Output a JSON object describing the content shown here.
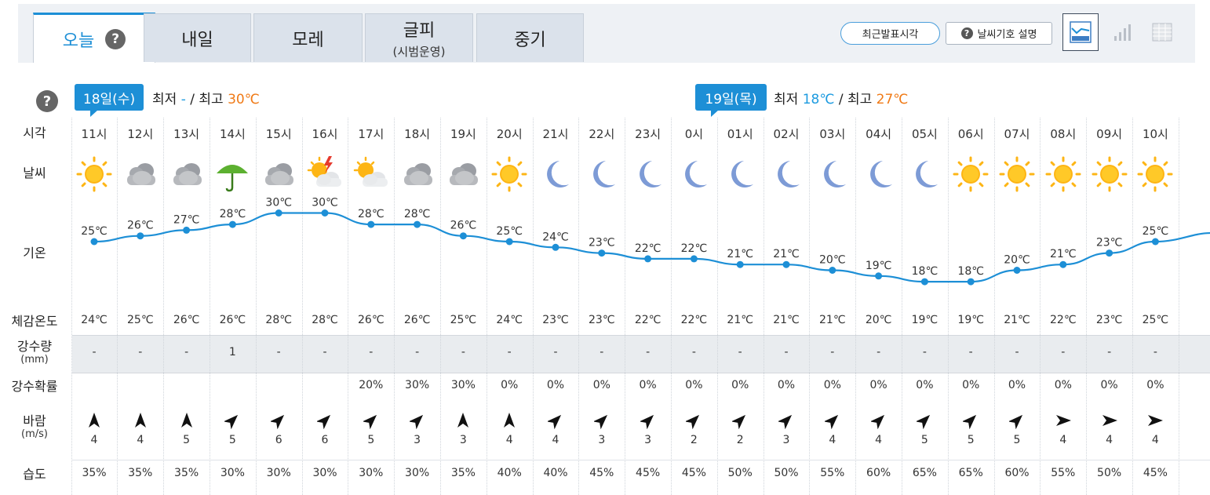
{
  "tabs": [
    {
      "label": "오늘",
      "sub": "",
      "active": true,
      "help": "?"
    },
    {
      "label": "내일",
      "sub": ""
    },
    {
      "label": "모레",
      "sub": ""
    },
    {
      "label": "글피",
      "sub": "(시범운영)"
    },
    {
      "label": "중기",
      "sub": ""
    }
  ],
  "toolbar": {
    "recent_label": "최근발표시각",
    "legend_label": "날씨기호 설명",
    "legend_icon": "?"
  },
  "help_icon": "?",
  "days": [
    {
      "badge": "18일(수)",
      "low_label": "최저",
      "low": "-",
      "sep": "/",
      "high_label": "최고",
      "high": "30℃"
    },
    {
      "badge": "19일(목)",
      "low_label": "최저",
      "low": "18℃",
      "sep": "/",
      "high_label": "최고",
      "high": "27℃"
    }
  ],
  "row_labels": {
    "hour": "시각",
    "weather": "날씨",
    "temp": "기온",
    "feels": "체감온도",
    "rain": "강수량",
    "rain_unit": "(mm)",
    "prob": "강수확률",
    "wind": "바람",
    "wind_unit": "(m/s)",
    "humidity": "습도"
  },
  "colors": {
    "accent": "#1d8fd6",
    "low": "#1d9be0",
    "high": "#f07a16"
  },
  "forecast": [
    {
      "hour": "11시",
      "weather": "sun",
      "temp": 25,
      "temp_label": "25℃",
      "feels": "24℃",
      "rain": "-",
      "prob": "",
      "wind_dir": "north",
      "wind": "4",
      "humidity": "35%"
    },
    {
      "hour": "12시",
      "weather": "cloud",
      "temp": 26,
      "temp_label": "26℃",
      "feels": "25℃",
      "rain": "-",
      "prob": "",
      "wind_dir": "north",
      "wind": "4",
      "humidity": "35%"
    },
    {
      "hour": "13시",
      "weather": "cloud",
      "temp": 27,
      "temp_label": "27℃",
      "feels": "26℃",
      "rain": "-",
      "prob": "",
      "wind_dir": "north",
      "wind": "5",
      "humidity": "35%"
    },
    {
      "hour": "14시",
      "weather": "umbrella",
      "temp": 28,
      "temp_label": "28℃",
      "feels": "26℃",
      "rain": "1",
      "prob": "",
      "wind_dir": "northeast",
      "wind": "5",
      "humidity": "30%"
    },
    {
      "hour": "15시",
      "weather": "cloud",
      "temp": 30,
      "temp_label": "30℃",
      "feels": "28℃",
      "rain": "-",
      "prob": "",
      "wind_dir": "northeast",
      "wind": "6",
      "humidity": "30%"
    },
    {
      "hour": "16시",
      "weather": "thunder",
      "temp": 30,
      "temp_label": "30℃",
      "feels": "28℃",
      "rain": "-",
      "prob": "",
      "wind_dir": "northeast",
      "wind": "6",
      "humidity": "30%"
    },
    {
      "hour": "17시",
      "weather": "suncloud",
      "temp": 28,
      "temp_label": "28℃",
      "feels": "26℃",
      "rain": "-",
      "prob": "20%",
      "wind_dir": "northeast",
      "wind": "5",
      "humidity": "30%"
    },
    {
      "hour": "18시",
      "weather": "cloud",
      "temp": 28,
      "temp_label": "28℃",
      "feels": "26℃",
      "rain": "-",
      "prob": "30%",
      "wind_dir": "northeast",
      "wind": "3",
      "humidity": "30%"
    },
    {
      "hour": "19시",
      "weather": "cloud",
      "temp": 26,
      "temp_label": "26℃",
      "feels": "25℃",
      "rain": "-",
      "prob": "30%",
      "wind_dir": "north",
      "wind": "3",
      "humidity": "35%"
    },
    {
      "hour": "20시",
      "weather": "sun",
      "temp": 25,
      "temp_label": "25℃",
      "feels": "24℃",
      "rain": "-",
      "prob": "0%",
      "wind_dir": "north",
      "wind": "4",
      "humidity": "40%"
    },
    {
      "hour": "21시",
      "weather": "moon",
      "temp": 24,
      "temp_label": "24℃",
      "feels": "23℃",
      "rain": "-",
      "prob": "0%",
      "wind_dir": "northeast",
      "wind": "4",
      "humidity": "40%"
    },
    {
      "hour": "22시",
      "weather": "moon",
      "temp": 23,
      "temp_label": "23℃",
      "feels": "23℃",
      "rain": "-",
      "prob": "0%",
      "wind_dir": "northeast",
      "wind": "3",
      "humidity": "45%"
    },
    {
      "hour": "23시",
      "weather": "moon",
      "temp": 22,
      "temp_label": "22℃",
      "feels": "22℃",
      "rain": "-",
      "prob": "0%",
      "wind_dir": "northeast",
      "wind": "3",
      "humidity": "45%"
    },
    {
      "hour": "0시",
      "weather": "moon",
      "temp": 22,
      "temp_label": "22℃",
      "feels": "22℃",
      "rain": "-",
      "prob": "0%",
      "wind_dir": "northeast",
      "wind": "2",
      "humidity": "45%"
    },
    {
      "hour": "01시",
      "weather": "moon",
      "temp": 21,
      "temp_label": "21℃",
      "feels": "21℃",
      "rain": "-",
      "prob": "0%",
      "wind_dir": "northeast",
      "wind": "2",
      "humidity": "50%"
    },
    {
      "hour": "02시",
      "weather": "moon",
      "temp": 21,
      "temp_label": "21℃",
      "feels": "21℃",
      "rain": "-",
      "prob": "0%",
      "wind_dir": "northeast",
      "wind": "3",
      "humidity": "50%"
    },
    {
      "hour": "03시",
      "weather": "moon",
      "temp": 20,
      "temp_label": "20℃",
      "feels": "21℃",
      "rain": "-",
      "prob": "0%",
      "wind_dir": "northeast",
      "wind": "4",
      "humidity": "55%"
    },
    {
      "hour": "04시",
      "weather": "moon",
      "temp": 19,
      "temp_label": "19℃",
      "feels": "20℃",
      "rain": "-",
      "prob": "0%",
      "wind_dir": "northeast",
      "wind": "4",
      "humidity": "60%"
    },
    {
      "hour": "05시",
      "weather": "moon",
      "temp": 18,
      "temp_label": "18℃",
      "feels": "19℃",
      "rain": "-",
      "prob": "0%",
      "wind_dir": "northeast",
      "wind": "5",
      "humidity": "65%"
    },
    {
      "hour": "06시",
      "weather": "sun",
      "temp": 18,
      "temp_label": "18℃",
      "feels": "19℃",
      "rain": "-",
      "prob": "0%",
      "wind_dir": "northeast",
      "wind": "5",
      "humidity": "65%"
    },
    {
      "hour": "07시",
      "weather": "sun",
      "temp": 20,
      "temp_label": "20℃",
      "feels": "21℃",
      "rain": "-",
      "prob": "0%",
      "wind_dir": "northeast",
      "wind": "5",
      "humidity": "60%"
    },
    {
      "hour": "08시",
      "weather": "sun",
      "temp": 21,
      "temp_label": "21℃",
      "feels": "22℃",
      "rain": "-",
      "prob": "0%",
      "wind_dir": "east",
      "wind": "4",
      "humidity": "55%"
    },
    {
      "hour": "09시",
      "weather": "sun",
      "temp": 23,
      "temp_label": "23℃",
      "feels": "23℃",
      "rain": "-",
      "prob": "0%",
      "wind_dir": "east",
      "wind": "4",
      "humidity": "50%"
    },
    {
      "hour": "10시",
      "weather": "sun",
      "temp": 25,
      "temp_label": "25℃",
      "feels": "25℃",
      "rain": "-",
      "prob": "0%",
      "wind_dir": "east",
      "wind": "4",
      "humidity": "45%"
    }
  ]
}
